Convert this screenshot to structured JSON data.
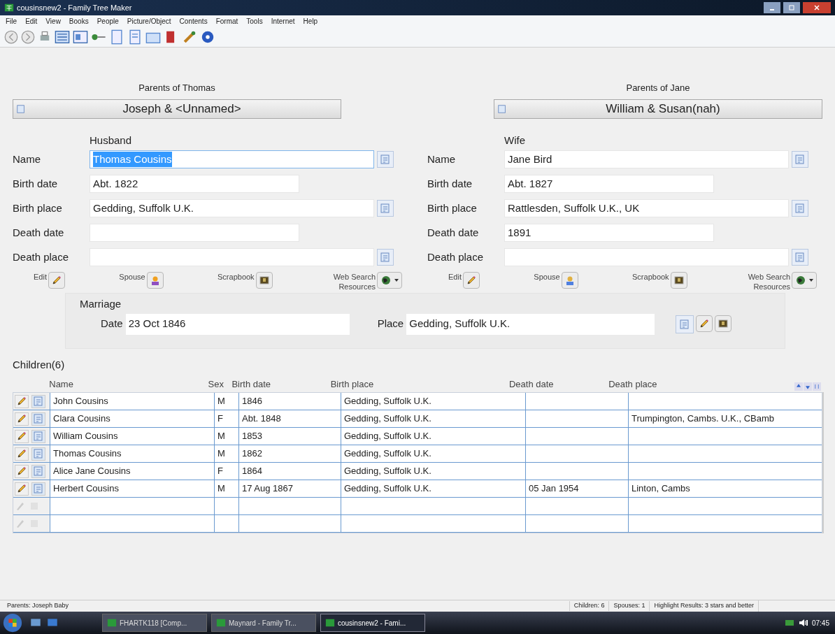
{
  "window": {
    "title": "cousinsnew2 - Family Tree Maker"
  },
  "menu": [
    "File",
    "Edit",
    "View",
    "Books",
    "People",
    "Picture/Object",
    "Contents",
    "Format",
    "Tools",
    "Internet",
    "Help"
  ],
  "parents": [
    {
      "label": "Parents of Thomas",
      "value": "Joseph & <Unnamed>"
    },
    {
      "label": "Parents of Jane",
      "value": "William & Susan(nah)"
    }
  ],
  "people": [
    {
      "heading": "Husband",
      "fields": [
        {
          "label": "Name",
          "value": "Thomas Cousins",
          "kind": "long",
          "highlighted": true
        },
        {
          "label": "Birth date",
          "value": "Abt. 1822",
          "kind": "short",
          "highlighted": false
        },
        {
          "label": "Birth place",
          "value": "Gedding, Suffolk U.K.",
          "kind": "long",
          "highlighted": false
        },
        {
          "label": "Death date",
          "kind": "short",
          "highlighted": false
        },
        {
          "label": "Death place",
          "kind": "long",
          "highlighted": false
        }
      ],
      "actions": [
        {
          "label": "Edit",
          "kind": "edit"
        },
        {
          "label": "Spouse",
          "kind": "spouse-female"
        },
        {
          "label": "Scrapbook",
          "kind": "scrapbook"
        },
        {
          "label": "Web Search Resources",
          "kind": "web"
        }
      ]
    },
    {
      "heading": "Wife",
      "fields": [
        {
          "label": "Name",
          "value": "Jane Bird",
          "kind": "long",
          "highlighted": false
        },
        {
          "label": "Birth date",
          "value": "Abt. 1827",
          "kind": "short",
          "highlighted": false
        },
        {
          "label": "Birth place",
          "value": "Rattlesden, Suffolk U.K., UK",
          "kind": "long",
          "highlighted": false
        },
        {
          "label": "Death date",
          "value": "1891",
          "kind": "short",
          "highlighted": false
        },
        {
          "label": "Death place",
          "kind": "long",
          "highlighted": false
        }
      ],
      "actions": [
        {
          "label": "Edit",
          "kind": "edit"
        },
        {
          "label": "Spouse",
          "kind": "spouse-male"
        },
        {
          "label": "Scrapbook",
          "kind": "scrapbook"
        },
        {
          "label": "Web Search Resources",
          "kind": "web"
        }
      ]
    }
  ],
  "marriage": {
    "heading": "Marriage",
    "date_label": "Date",
    "date": "23 Oct 1846",
    "place_label": "Place",
    "place": "Gedding, Suffolk U.K."
  },
  "children": {
    "title": "Children(6)",
    "columns": [
      "Name",
      "Sex",
      "Birth date",
      "Birth place",
      "Death date",
      "Death place"
    ],
    "rows": [
      {
        "kind": "person",
        "cells": [
          "John Cousins",
          "M",
          "1846",
          "Gedding, Suffolk U.K.",
          "",
          ""
        ]
      },
      {
        "kind": "person",
        "cells": [
          "Clara Cousins",
          "F",
          "Abt. 1848",
          "Gedding, Suffolk U.K.",
          "",
          "Trumpington, Cambs. U.K., CBamb"
        ]
      },
      {
        "kind": "person",
        "cells": [
          "William Cousins",
          "M",
          "1853",
          "Gedding, Suffolk U.K.",
          "",
          ""
        ]
      },
      {
        "kind": "person",
        "cells": [
          "Thomas Cousins",
          "M",
          "1862",
          "Gedding, Suffolk U.K.",
          "",
          ""
        ]
      },
      {
        "kind": "person",
        "cells": [
          "Alice Jane Cousins",
          "F",
          "1864",
          "Gedding, Suffolk U.K.",
          "",
          ""
        ]
      },
      {
        "kind": "person",
        "cells": [
          "Herbert Cousins",
          "M",
          "17 Aug 1867",
          "Gedding, Suffolk U.K.",
          "05 Jan 1954",
          "Linton, Cambs"
        ]
      },
      {
        "kind": "blank"
      },
      {
        "kind": "blank"
      }
    ]
  },
  "status_bar": {
    "left": "Parents: Joseph Baby",
    "panels": [
      "Children: 6",
      "Spouses: 1",
      "Highlight Results: 3 stars and better"
    ]
  },
  "taskbar": {
    "items": [
      {
        "label": "FHARTK118 [Comp...",
        "selected": false
      },
      {
        "label": "Maynard - Family Tr...",
        "selected": false
      },
      {
        "label": "cousinsnew2 - Fami...",
        "selected": true
      }
    ],
    "clock": "07:45"
  }
}
